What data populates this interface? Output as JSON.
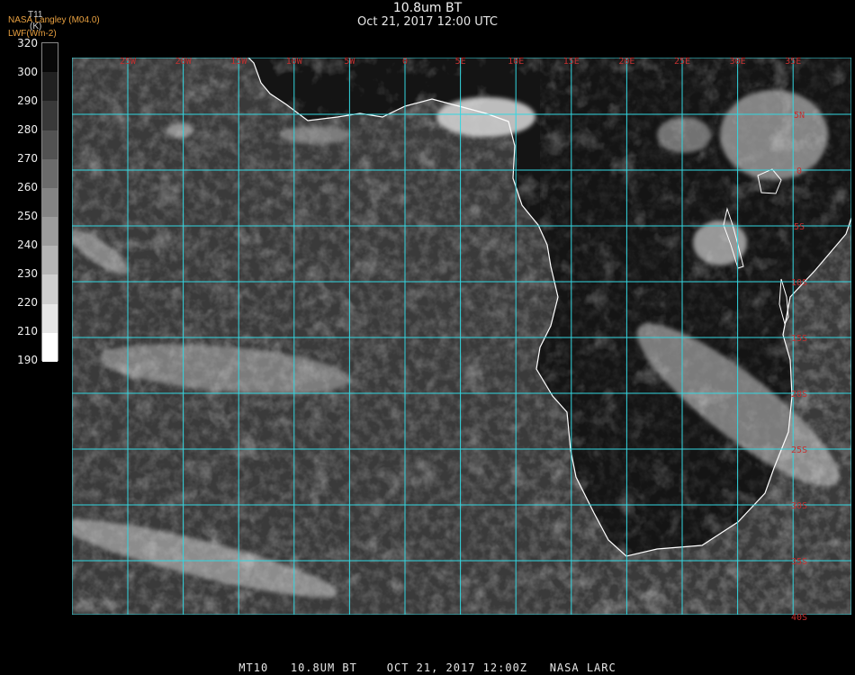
{
  "header": {
    "title": "10.8um BT",
    "datetime": "Oct 21, 2017 12:00 UTC",
    "credit_line1": "NASA Langley (M04.0)",
    "credit_line2": "LWF(Wm-2)"
  },
  "colorbar": {
    "variable": "T11",
    "unit": "(K)",
    "ticks": [
      "320",
      "300",
      "290",
      "280",
      "270",
      "260",
      "250",
      "240",
      "230",
      "220",
      "210",
      "190"
    ]
  },
  "map": {
    "lon_labels": [
      "25W",
      "20W",
      "15W",
      "10W",
      "5W",
      "0",
      "5E",
      "10E",
      "15E",
      "20E",
      "25E",
      "30E",
      "35E"
    ],
    "lat_labels": [
      "5N",
      "0",
      "5S",
      "10S",
      "15S",
      "20S",
      "25S",
      "30S",
      "35S",
      "40S"
    ],
    "grid_color": "#33d6e0",
    "coast_color": "#ffffff",
    "label_color": "#c43030"
  },
  "footer": {
    "text": "MT10   10.8UM BT    OCT 21, 2017 12:00Z   NASA LARC"
  }
}
